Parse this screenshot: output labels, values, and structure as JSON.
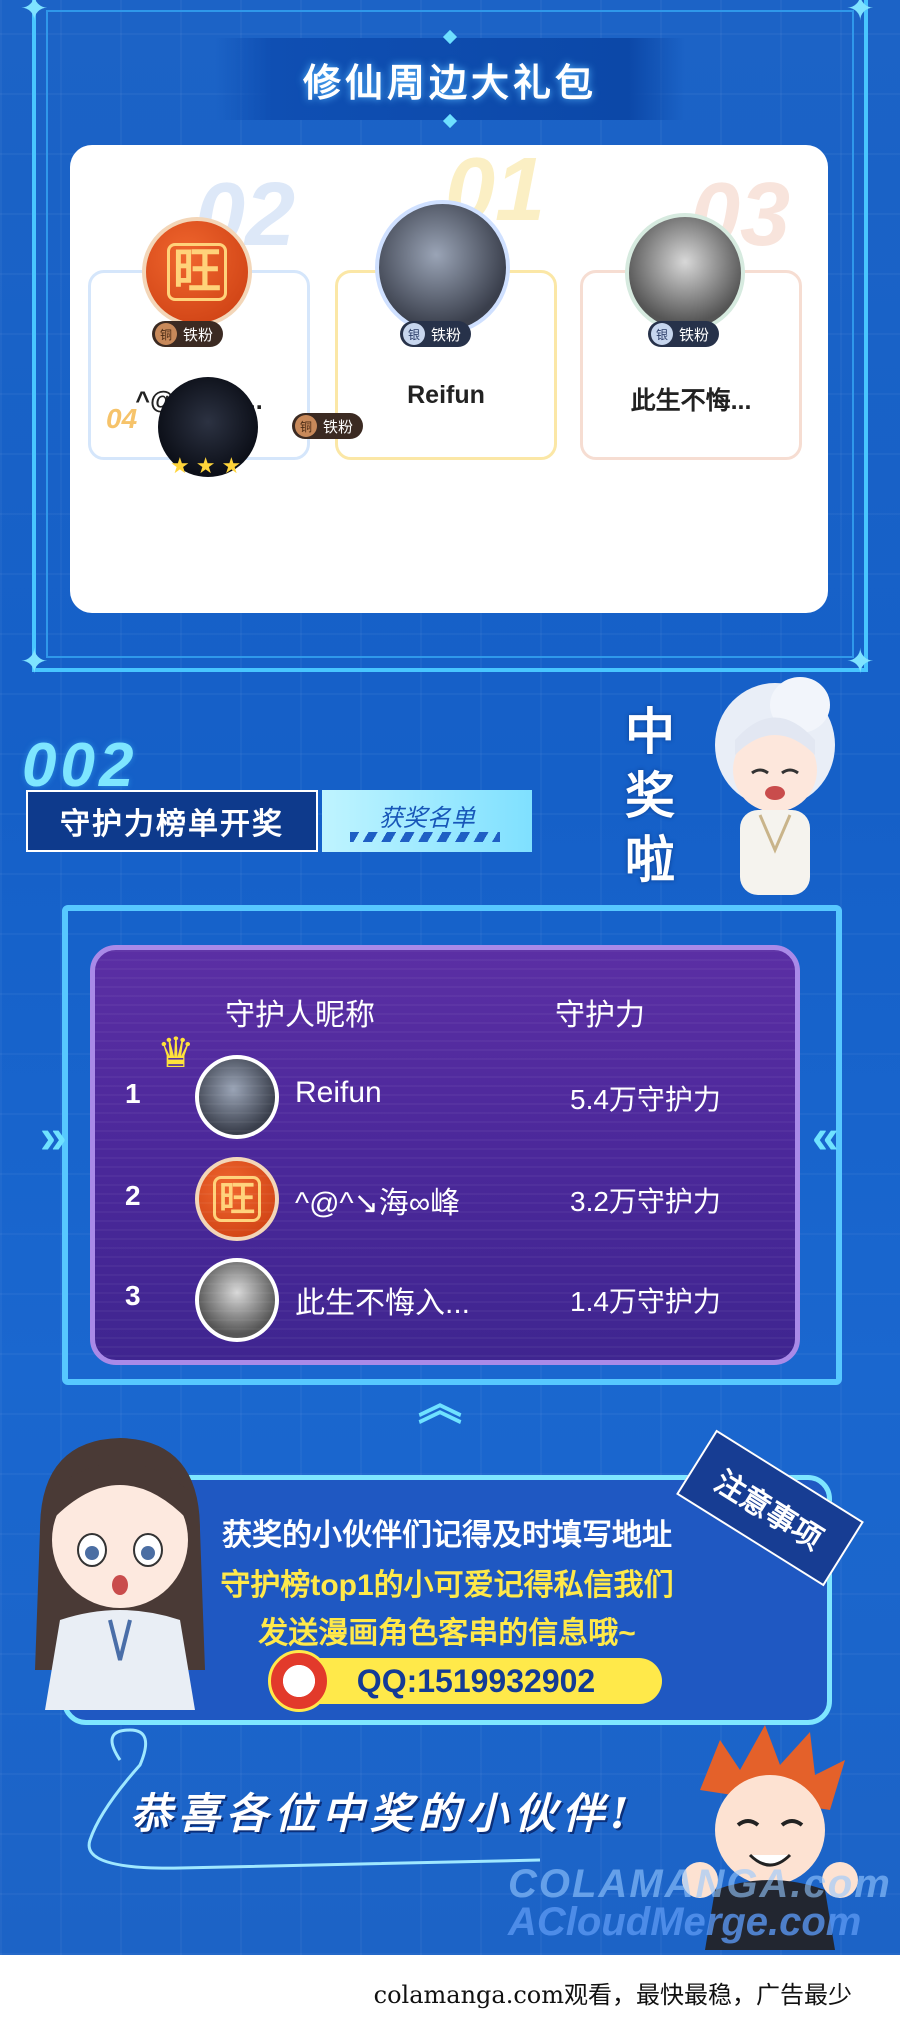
{
  "gift_section": {
    "title": "修仙周边大礼包",
    "podium": [
      {
        "rank_label": "02",
        "badge_coin": "铜",
        "badge_text": "铁粉",
        "name": "^@^↘海 ..."
      },
      {
        "rank_label": "01",
        "badge_coin": "银",
        "badge_text": "铁粉",
        "name": "Reifun"
      },
      {
        "rank_label": "03",
        "badge_coin": "银",
        "badge_text": "铁粉",
        "name": "此生不悔..."
      }
    ],
    "fourth": {
      "rank_label": "04",
      "badge_coin": "铜",
      "badge_text": "铁粉"
    }
  },
  "guardian_section": {
    "section_number": "002",
    "tab_main": "守护力榜单开奖",
    "tab_sub": "获奖名单",
    "side_text": [
      "中",
      "奖",
      "啦"
    ]
  },
  "leaderboard": {
    "col_name": "守护人昵称",
    "col_value": "守护力",
    "rows": [
      {
        "rank": "1",
        "name": "Reifun",
        "value": "5.4万守护力"
      },
      {
        "rank": "2",
        "name": "^@^↘海∞峰",
        "value": "3.2万守护力"
      },
      {
        "rank": "3",
        "name": "此生不悔入...",
        "value": "1.4万守护力"
      }
    ]
  },
  "notice": {
    "tag": "注意事项",
    "lines": [
      {
        "text": "获奖的小伙伴们记得及时填写地址",
        "color": "#ffffff"
      },
      {
        "text": "守护榜top1的小可爱记得私信我们",
        "color": "#ffe94a"
      },
      {
        "text": "发送漫画角色客串的信息哦~",
        "color": "#ffe94a"
      }
    ],
    "qq": "QQ:1519932902"
  },
  "congrats": "恭喜各位中奖的小伙伴!",
  "watermark": {
    "line1": "COLAMANGA.com",
    "line2": "ACloudMerge.com"
  },
  "footer": "colamanga.com观看，最快最稳，广告最少",
  "colors": {
    "background": "#1c63c6",
    "accent": "#7ee6ff",
    "board": "#4b289a",
    "highlight": "#ffe94a"
  }
}
